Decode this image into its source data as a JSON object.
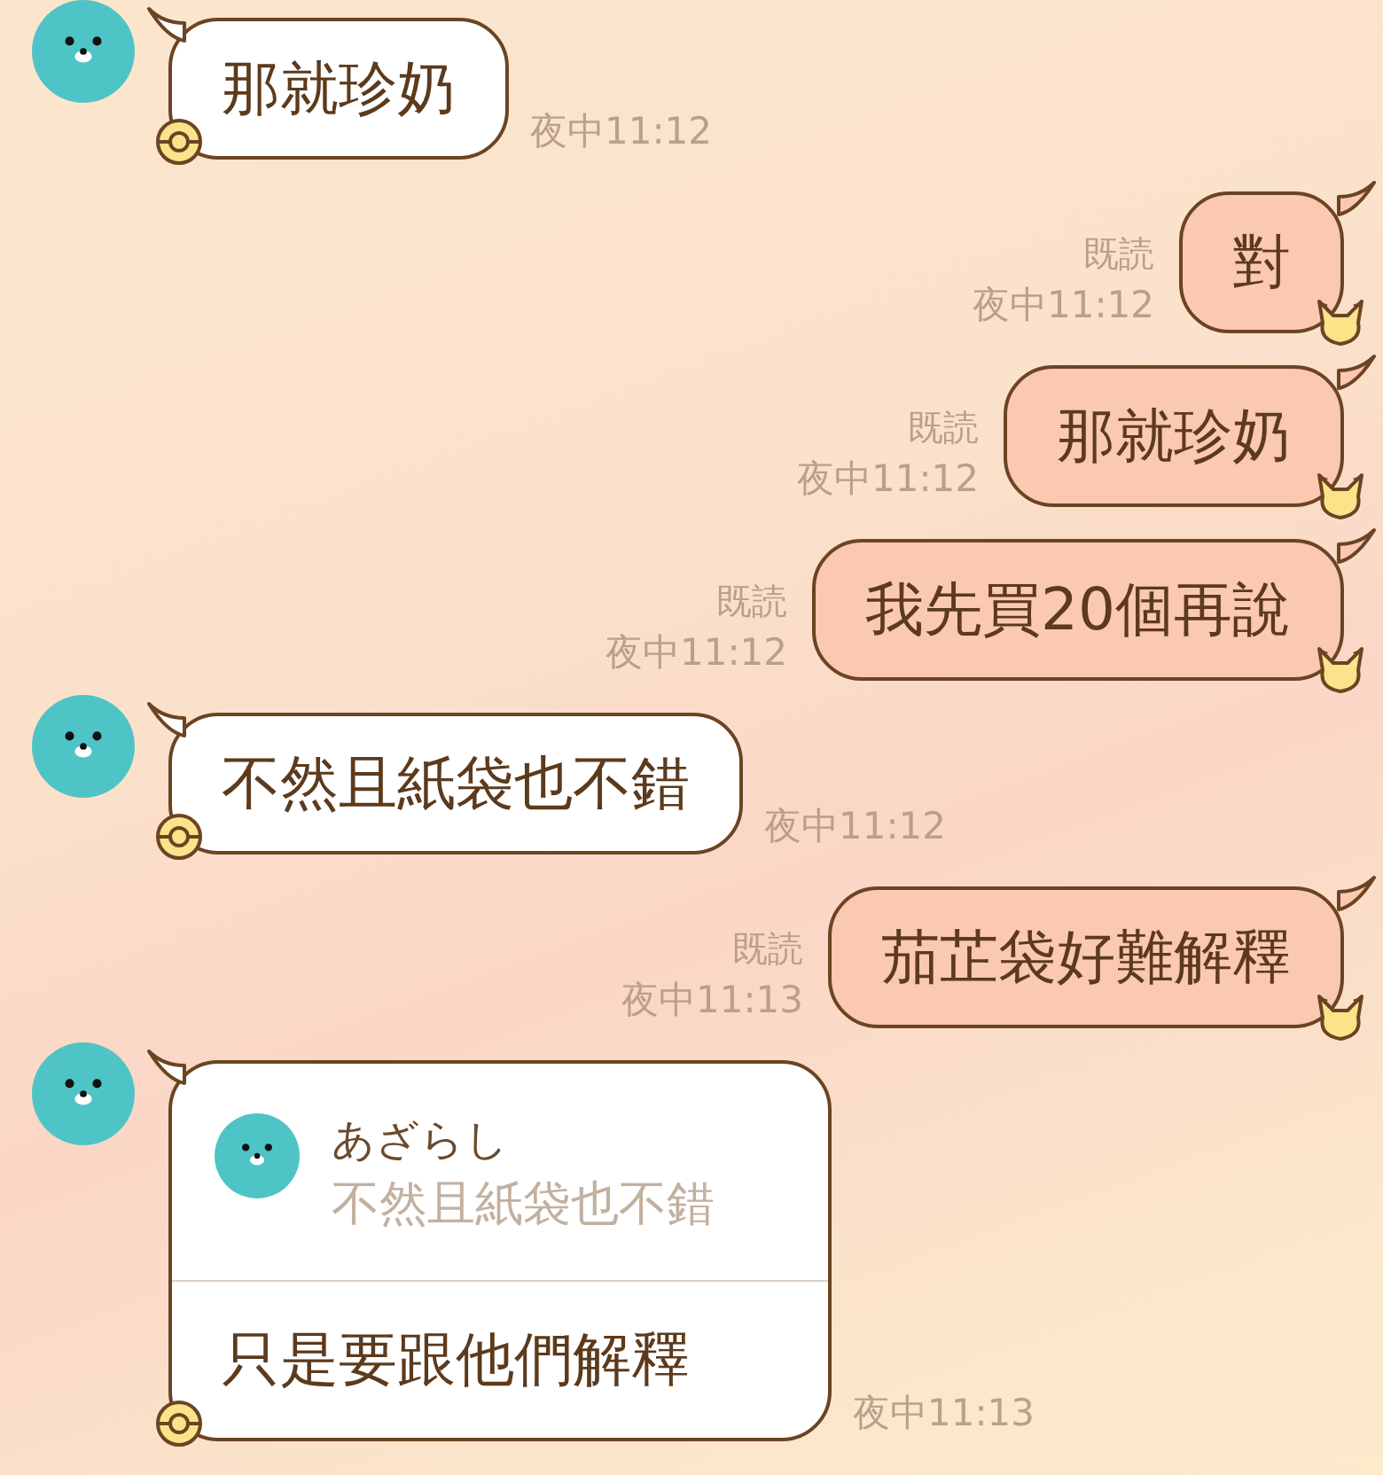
{
  "messages": [
    {
      "kind": "incoming",
      "text": "那就珍奶",
      "time": "夜中11:12"
    },
    {
      "kind": "outgoing",
      "text": "對",
      "read": "既読",
      "time": "夜中11:12"
    },
    {
      "kind": "outgoing",
      "text": "那就珍奶",
      "read": "既読",
      "time": "夜中11:12"
    },
    {
      "kind": "outgoing",
      "text": "我先買20個再說",
      "read": "既読",
      "time": "夜中11:12"
    },
    {
      "kind": "incoming",
      "text": "不然且紙袋也不錯",
      "time": "夜中11:12"
    },
    {
      "kind": "outgoing",
      "text": "茄芷袋好難解釋",
      "read": "既読",
      "time": "夜中11:13"
    },
    {
      "kind": "incoming",
      "text": "只是要跟他們解釋",
      "time": "夜中11:13",
      "reply": {
        "name": "あざらし",
        "text": "不然且紙袋也不錯"
      }
    }
  ]
}
